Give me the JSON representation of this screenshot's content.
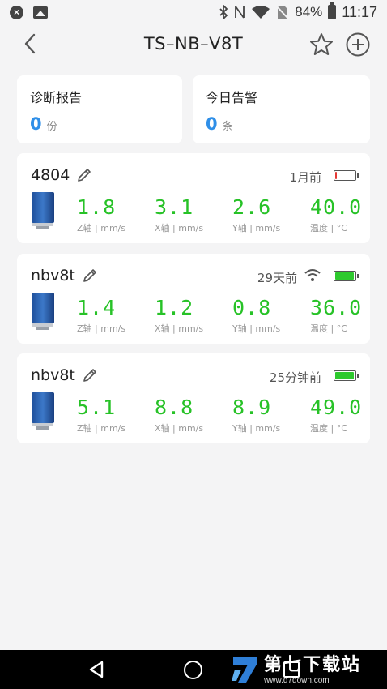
{
  "status_bar": {
    "battery_percent": "84%",
    "time": "11:17",
    "icons": [
      "close-circle-icon",
      "image-icon",
      "bluetooth-icon",
      "nfc-icon",
      "wifi-icon",
      "no-sim-icon",
      "battery-icon"
    ]
  },
  "header": {
    "title": "TS–NB–V8T",
    "icons": [
      "back-icon",
      "star-icon",
      "add-icon"
    ]
  },
  "summary": [
    {
      "label": "诊断报告",
      "count": "0",
      "unit": "份"
    },
    {
      "label": "今日告警",
      "count": "0",
      "unit": "条"
    }
  ],
  "devices": [
    {
      "name": "4804",
      "time": "1月前",
      "wifi": false,
      "battery_level": 0.1,
      "battery_color": "#e53935",
      "metrics": [
        {
          "value": "1.8",
          "label": "Z轴 | mm/s"
        },
        {
          "value": "3.1",
          "label": "X轴 | mm/s"
        },
        {
          "value": "2.6",
          "label": "Y轴 | mm/s"
        },
        {
          "value": "40.0",
          "label": "温度 | °C"
        }
      ]
    },
    {
      "name": "nbv8t",
      "time": "29天前",
      "wifi": true,
      "battery_level": 1.0,
      "battery_color": "#2ec92e",
      "metrics": [
        {
          "value": "1.4",
          "label": "Z轴 | mm/s"
        },
        {
          "value": "1.2",
          "label": "X轴 | mm/s"
        },
        {
          "value": "0.8",
          "label": "Y轴 | mm/s"
        },
        {
          "value": "36.0",
          "label": "温度 | °C"
        }
      ]
    },
    {
      "name": "nbv8t",
      "time": "25分钟前",
      "wifi": false,
      "battery_level": 1.0,
      "battery_color": "#2ec92e",
      "metrics": [
        {
          "value": "5.1",
          "label": "Z轴 | mm/s"
        },
        {
          "value": "8.8",
          "label": "X轴 | mm/s"
        },
        {
          "value": "8.9",
          "label": "Y轴 | mm/s"
        },
        {
          "value": "49.0",
          "label": "温度 | °C"
        }
      ]
    }
  ],
  "watermark": {
    "main": "第七下载站",
    "url": "www.d7down.com"
  },
  "colors": {
    "accent_blue": "#2f8fe8",
    "value_green": "#27c227",
    "sensor_blue": "#2f5fa8"
  }
}
